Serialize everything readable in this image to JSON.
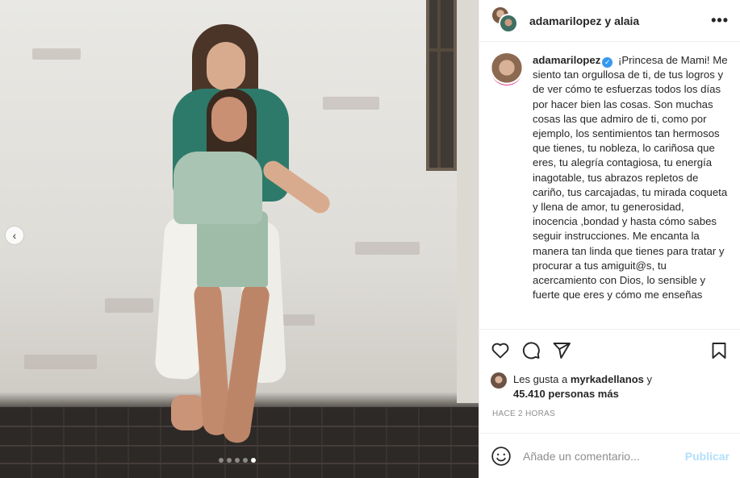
{
  "post": {
    "header": {
      "username": "adamarilopez",
      "separator": "y",
      "coauthor": "alaia",
      "more_icon": "more-horizontal-icon"
    },
    "caption": {
      "username": "adamarilopez",
      "verified_icon": "verified-badge-icon",
      "text": "¡Princesa de Mami! Me siento tan orgullosa de ti, de tus logros y de ver cómo te esfuerzas todos los días por hacer bien las cosas. Son muchas cosas las que admiro de ti, como por ejemplo, los sentimientos tan hermosos que tienes, tu nobleza, lo cariñosa que eres, tu alegría contagiosa, tu energía inagotable, tus abrazos repletos de cariño, tus carcajadas, tu mirada coqueta y llena de amor, tu generosidad, inocencia ,bondad y hasta cómo sabes seguir instrucciones. Me encanta la manera tan linda que tienes para tratar y procurar a tus amiguit@s, tu acercamiento con Dios, lo sensible y fuerte que eres y cómo me enseñas"
    },
    "actions": {
      "like_icon": "heart-icon",
      "comment_icon": "comment-icon",
      "share_icon": "share-icon",
      "save_icon": "bookmark-icon"
    },
    "likes": {
      "prefix": "Les gusta a",
      "liker": "myrkadellanos",
      "conj": "y",
      "count_text": "45.410 personas más"
    },
    "timestamp": "HACE 2 HORAS",
    "comment": {
      "emoji_icon": "emoji-icon",
      "placeholder": "Añade un comentario...",
      "publish_label": "Publicar"
    },
    "carousel": {
      "prev_icon": "chevron-left-icon",
      "prev_glyph": "‹",
      "slide_count": 5,
      "active_index": 4
    }
  }
}
